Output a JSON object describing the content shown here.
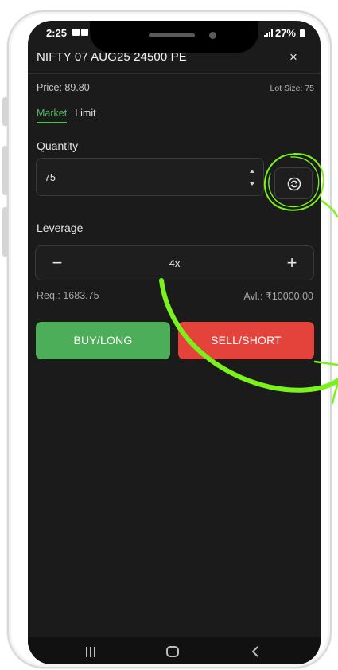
{
  "status_bar": {
    "time": "2:25",
    "battery": "27%"
  },
  "header": {
    "title": "NIFTY 07 AUG25 24500 PE",
    "close_label": "×"
  },
  "info": {
    "price": "Price: 89.80",
    "lot_size": "Lot Size: 75"
  },
  "tabs": [
    {
      "label": "Market",
      "active": true
    },
    {
      "label": "Limit",
      "active": false
    }
  ],
  "quantity": {
    "label": "Quantity",
    "value": "75"
  },
  "leverage": {
    "label": "Leverage",
    "minus": "−",
    "value": "4x",
    "plus": "+"
  },
  "margin": {
    "required": "Req.: 1683.75",
    "available": "Avl.: ₹10000.00"
  },
  "actions": {
    "buy_label": "BUY/LONG",
    "sell_label": "SELL/SHORT"
  },
  "colors": {
    "buy": "#4cae58",
    "sell": "#e3433a",
    "accent": "#52b95e",
    "annotation": "#7cf21c",
    "background": "#1b1b1b"
  },
  "icons": {
    "swap": "swap-icon",
    "close": "close-icon",
    "nav_recent": "recent-apps-icon",
    "nav_home": "home-icon",
    "nav_back": "back-icon"
  }
}
